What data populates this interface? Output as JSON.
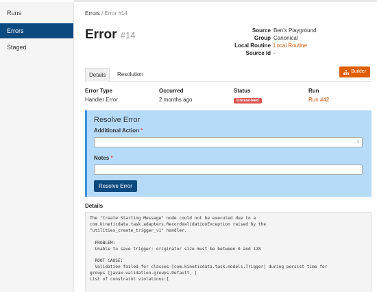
{
  "sidebar": {
    "items": [
      {
        "label": "Runs"
      },
      {
        "label": "Errors"
      },
      {
        "label": "Staged"
      }
    ]
  },
  "breadcrumb": {
    "parent": "Errors",
    "separator": "/",
    "current": "Error #14"
  },
  "page": {
    "title": "Error",
    "number": "#14"
  },
  "meta": {
    "source_label": "Source",
    "source_value": "Ben's Playground",
    "group_label": "Group",
    "group_value": "Canonical",
    "routine_label": "Local Routine",
    "routine_value": "Local Routine",
    "source_id_label": "Source Id",
    "source_id_value": "-"
  },
  "tabs": [
    {
      "label": "Details"
    },
    {
      "label": "Resolution"
    }
  ],
  "builder_button": {
    "label": "Builder"
  },
  "info": {
    "error_type_h": "Error Type",
    "error_type_v": "Handler Error",
    "occurred_h": "Occurred",
    "occurred_v": "2 months ago",
    "status_h": "Status",
    "status_v": "Unresolved",
    "run_h": "Run",
    "run_v": "Run #42"
  },
  "resolve": {
    "title": "Resolve Error",
    "action_label": "Additional Action",
    "notes_label": "Notes",
    "required_mark": "*",
    "button": "Resolve Error"
  },
  "details": {
    "heading": "Details",
    "text": "The \"Create Starting Message\" node could not be executed due to a\ncom.kineticdata.task.adapters.RecordValidationException raised by the\n\"utilities_create_trigger_v1\" handler.\n\n  PROBLEM:\n  Unable to save trigger: originator size must be between 0 and 128\n\n  ROOT CAUSE:\n  Validation failed for classes [com.kineticdata.task.models.Trigger] during persist time for\ngroups [javax.validation.groups.Default, ]\nList of constraint violations:["
  },
  "colors": {
    "accent": "#0a4a7f",
    "orange": "#e05d00",
    "danger": "#d9534f",
    "panel": "#b6dbf9"
  }
}
